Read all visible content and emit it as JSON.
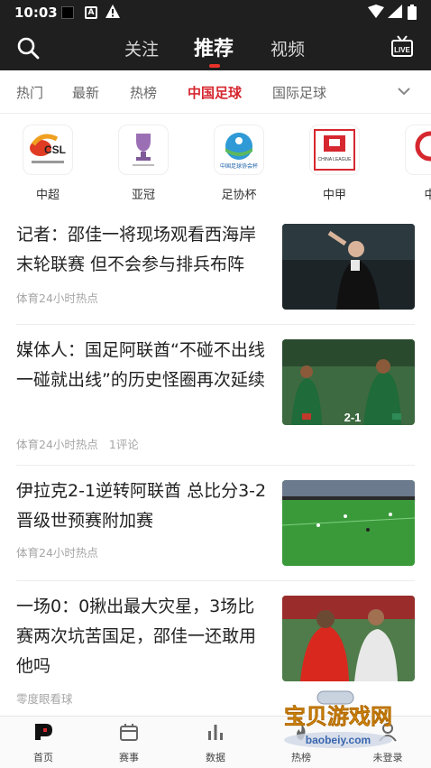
{
  "status_bar": {
    "time": "10:03"
  },
  "top_nav": {
    "tabs": [
      "关注",
      "推荐",
      "视频"
    ],
    "active_tab": "推荐",
    "live_label": "LIVE"
  },
  "category_tabs": {
    "items": [
      "热门",
      "最新",
      "热榜",
      "中国足球",
      "国际足球"
    ],
    "active": "中国足球"
  },
  "leagues": [
    {
      "name": "中超",
      "logo_text": "CSL"
    },
    {
      "name": "亚冠",
      "logo_text": ""
    },
    {
      "name": "足协杯",
      "logo_text": "中国足球协会杯"
    },
    {
      "name": "中甲",
      "logo_text": "CHINA LEAGUE"
    },
    {
      "name": "中",
      "logo_text": ""
    }
  ],
  "feed": [
    {
      "title": "记者：邵佳一将现场观看西海岸末轮联赛 但不会参与排兵布阵",
      "source": "体育24小时热点",
      "comments": ""
    },
    {
      "title": "媒体人：国足阿联酋“不碰不出线一碰就出线”的历史怪圈再次延续",
      "source": "体育24小时热点",
      "comments": "1评论",
      "score": "2-1"
    },
    {
      "title": "伊拉克2-1逆转阿联酋 总比分3-2晋级世预赛附加赛",
      "source": "体育24小时热点",
      "comments": ""
    },
    {
      "title": "一场0：0揪出最大灾星，3场比赛两次坑苦国足，邵佳一还敢用他吗",
      "source": "零度眼看球",
      "comments": ""
    }
  ],
  "bottom_nav": [
    "首页",
    "赛事",
    "数据",
    "热榜",
    "未登录"
  ],
  "watermark": {
    "line1": "宝贝游戏网",
    "line2": "baobeiy.com"
  },
  "colors": {
    "accent": "#d6272f",
    "header_bg": "#1f1f1f"
  }
}
